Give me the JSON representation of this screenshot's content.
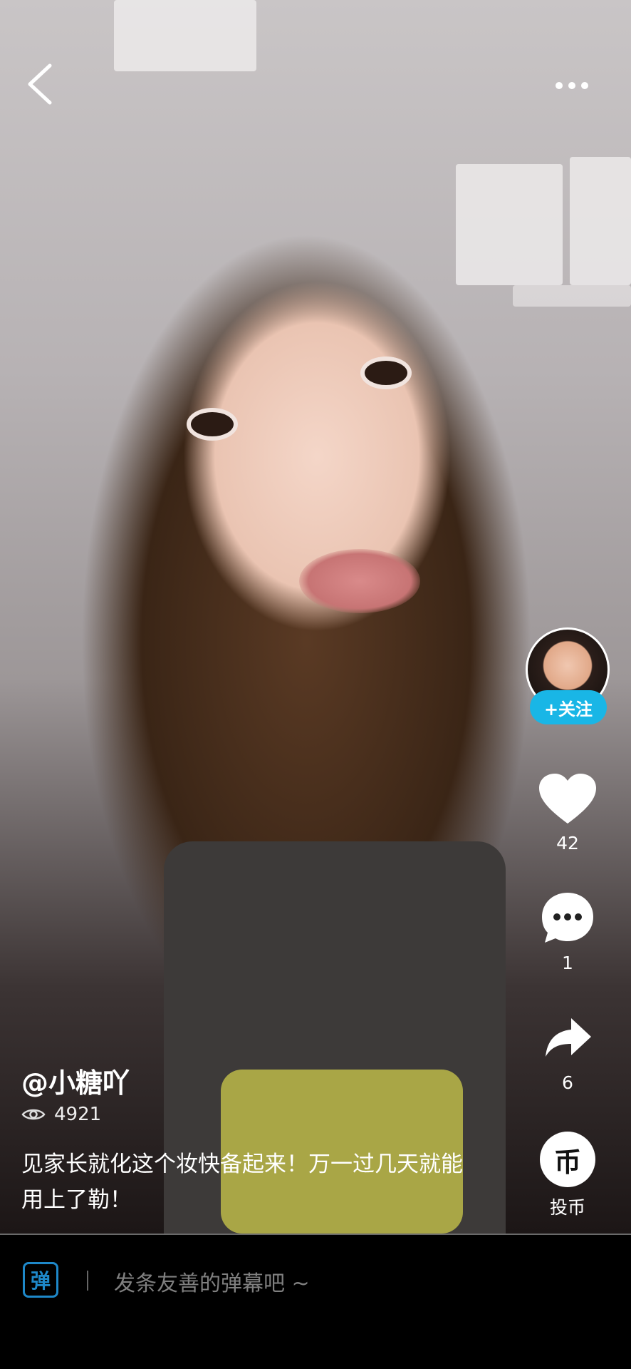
{
  "video": {
    "background_icon": "video-frame"
  },
  "top_bar": {
    "back_icon": "chevron-left-icon",
    "more_icon": "more-dots-icon"
  },
  "author": {
    "avatar_icon": "avatar",
    "follow_label": "+关注"
  },
  "actions": {
    "like": {
      "icon": "heart-icon",
      "count": "42"
    },
    "comment": {
      "icon": "comment-icon",
      "count": "1"
    },
    "share": {
      "icon": "share-icon",
      "count": "6"
    },
    "coin": {
      "icon": "coin-icon",
      "glyph": "币",
      "label": "投币"
    }
  },
  "info": {
    "username": "@小糖吖",
    "views": "4921",
    "caption": "见家长就化这个妆快备起来！万一过几天就能用上了勒！"
  },
  "bottom_bar": {
    "danmaku_glyph": "弹",
    "input_placeholder": "发条友善的弹幕吧 ~"
  },
  "colors": {
    "accent": "#19b6e6",
    "danmaku_icon": "#1e88c9"
  }
}
